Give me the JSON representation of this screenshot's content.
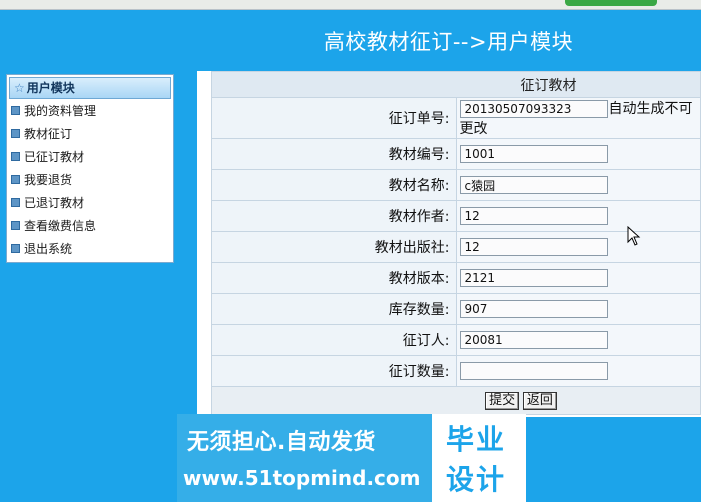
{
  "header": {
    "title": "高校教材征订-->用户模块"
  },
  "sidebar": {
    "title": "用户模块",
    "items": [
      {
        "label": "我的资料管理"
      },
      {
        "label": "教材征订"
      },
      {
        "label": "已征订教材"
      },
      {
        "label": "我要退货"
      },
      {
        "label": "已退订教材"
      },
      {
        "label": "查看缴费信息"
      },
      {
        "label": "退出系统"
      }
    ]
  },
  "form": {
    "title": "征订教材",
    "order_no": {
      "label": "征订单号:",
      "value": "20130507093323",
      "note": "自动生成不可更改"
    },
    "book_no": {
      "label": "教材编号:",
      "value": "1001"
    },
    "book_name": {
      "label": "教材名称:",
      "value": "c猿园"
    },
    "author": {
      "label": "教材作者:",
      "value": "12"
    },
    "publisher": {
      "label": "教材出版社:",
      "value": "12"
    },
    "edition": {
      "label": "教材版本:",
      "value": "2121"
    },
    "stock": {
      "label": "库存数量:",
      "value": "907"
    },
    "subscriber": {
      "label": "征订人:",
      "value": "20081"
    },
    "quantity": {
      "label": "征订数量:",
      "value": ""
    },
    "submit_label": "提交",
    "back_label": "返回"
  },
  "watermark": {
    "line1": "无须担心.自动发货",
    "line2": "www.51topmind.com",
    "right1": "毕业",
    "right2": "设计"
  },
  "colors": {
    "background": "#1ca4ea",
    "panel": "#ffffff",
    "table_border": "#c6d5e2"
  }
}
